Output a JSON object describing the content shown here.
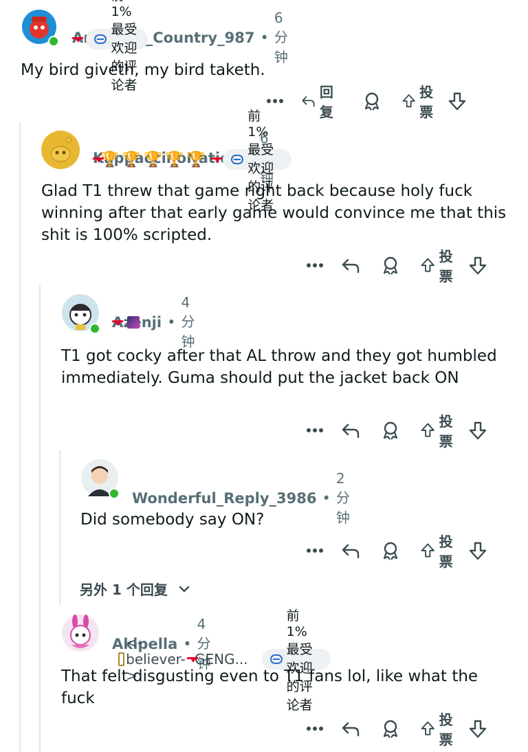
{
  "comments": [
    {
      "username": "Aromatic_Country_987",
      "time": "6分钟",
      "badge": "前 1% 最受欢迎的评论者",
      "body": "My bird giveth, my bird taketh.",
      "reply_label": "回复",
      "vote_label": "投票"
    },
    {
      "username": "KappaccinoNation",
      "time": "6分钟",
      "badge": "前 1% 最受欢迎的评论者",
      "trophies": [
        "🏆",
        "🏆",
        "🏆",
        "🏆",
        "🏆"
      ],
      "body": "Glad T1 threw that game right back because holy fuck winning after that early game would convince me that this shit is 100% scripted.",
      "vote_label": "投票"
    },
    {
      "username": "Azenji",
      "time": "4分钟",
      "body": "T1 got cocky after that AL throw and they got humbled immediately. Guma should put the jacket back ON",
      "vote_label": "投票"
    },
    {
      "username": "Wonderful_Reply_3986",
      "time": "2分钟",
      "body": "Did somebody say ON?",
      "vote_label": "投票"
    },
    {
      "username": "Akipella",
      "time": "4分钟",
      "flair_text": "<-believer->",
      "flair_text2": "GENG...",
      "badge": "前 1% 最受欢迎的评论者",
      "body": "That felt disgusting even to T1 fans lol, like what the fuck",
      "vote_label": "投票"
    }
  ],
  "more_replies": "另外 1 个回复",
  "more_icon": "ellipsis-icon",
  "colors": {
    "accent_red": "#e4002b",
    "meta": "#576f76",
    "badge_bg": "#eef1f3",
    "thread": "#e3e6e8"
  }
}
